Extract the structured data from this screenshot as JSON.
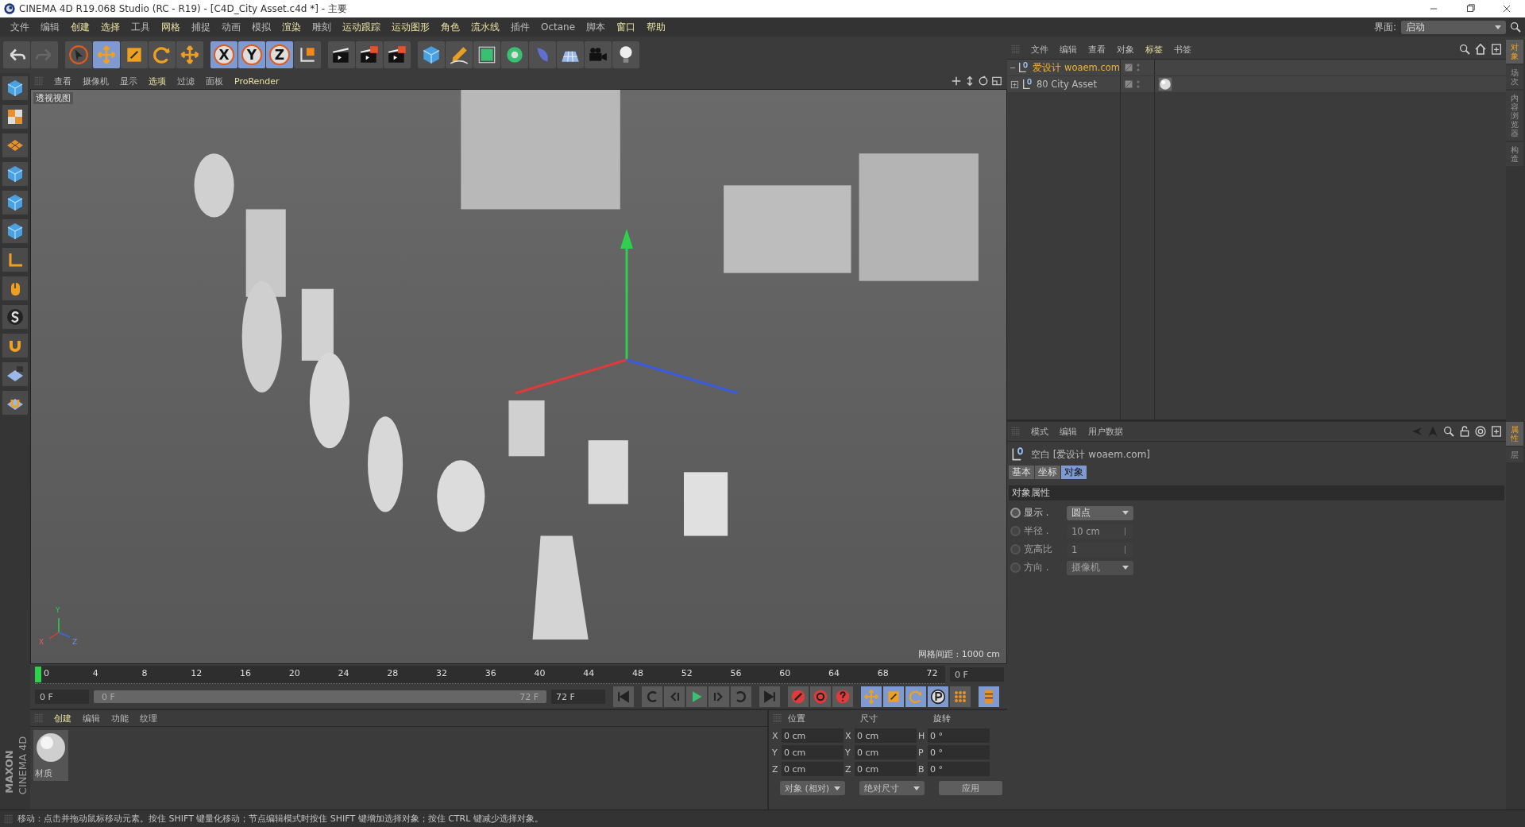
{
  "window": {
    "title": "CINEMA 4D R19.068 Studio (RC - R19) - [C4D_City Asset.c4d *] - 主要"
  },
  "menu_bar": [
    {
      "label": "文件",
      "highlighted": false
    },
    {
      "label": "编辑",
      "highlighted": false
    },
    {
      "label": "创建",
      "highlighted": true
    },
    {
      "label": "选择",
      "highlighted": true
    },
    {
      "label": "工具",
      "highlighted": false
    },
    {
      "label": "网格",
      "highlighted": true
    },
    {
      "label": "捕捉",
      "highlighted": false
    },
    {
      "label": "动画",
      "highlighted": false
    },
    {
      "label": "模拟",
      "highlighted": false
    },
    {
      "label": "渲染",
      "highlighted": true
    },
    {
      "label": "雕刻",
      "highlighted": false
    },
    {
      "label": "运动跟踪",
      "highlighted": true
    },
    {
      "label": "运动图形",
      "highlighted": true
    },
    {
      "label": "角色",
      "highlighted": true
    },
    {
      "label": "流水线",
      "highlighted": true
    },
    {
      "label": "插件",
      "highlighted": false
    },
    {
      "label": "Octane",
      "highlighted": false
    },
    {
      "label": "脚本",
      "highlighted": false
    },
    {
      "label": "窗口",
      "highlighted": true
    },
    {
      "label": "帮助",
      "highlighted": true
    }
  ],
  "layout_selector": {
    "label": "界面:",
    "value": "启动"
  },
  "toolbar": [
    {
      "kind": "undo",
      "selected": false
    },
    {
      "kind": "redo",
      "selected": false
    },
    {
      "kind": "select",
      "selected": false
    },
    {
      "kind": "move",
      "selected": true
    },
    {
      "kind": "scale",
      "selected": false
    },
    {
      "kind": "rotate",
      "selected": false
    },
    {
      "kind": "move",
      "selected": false
    },
    {
      "kind": "axis",
      "label": "X",
      "selected": true
    },
    {
      "kind": "axis",
      "label": "Y",
      "selected": true
    },
    {
      "kind": "axis",
      "label": "Z",
      "selected": true
    },
    {
      "kind": "coords",
      "selected": false
    },
    {
      "kind": "render-view",
      "selected": false
    },
    {
      "kind": "render-picture",
      "selected": false
    },
    {
      "kind": "render-settings",
      "selected": false
    },
    {
      "kind": "cube",
      "selected": false
    },
    {
      "kind": "pen",
      "selected": false
    },
    {
      "kind": "subdivide",
      "selected": false
    },
    {
      "kind": "cloner",
      "selected": false
    },
    {
      "kind": "deformer",
      "selected": false
    },
    {
      "kind": "floor",
      "selected": false
    },
    {
      "kind": "camera",
      "selected": false
    },
    {
      "kind": "light",
      "selected": false
    }
  ],
  "viewport": {
    "menu": [
      {
        "label": "查看",
        "highlighted": false
      },
      {
        "label": "摄像机",
        "highlighted": false
      },
      {
        "label": "显示",
        "highlighted": false
      },
      {
        "label": "选项",
        "highlighted": true
      },
      {
        "label": "过滤",
        "highlighted": false
      },
      {
        "label": "面板",
        "highlighted": false
      },
      {
        "label": "ProRender",
        "highlighted": true
      }
    ],
    "view_name": "透视视图",
    "axis_labels": [
      "Y",
      "X",
      "Z"
    ],
    "grid_spacing": "网格间距 : 1000 cm"
  },
  "timeline": {
    "ticks": [
      "0",
      "4",
      "8",
      "12",
      "16",
      "20",
      "24",
      "28",
      "32",
      "36",
      "40",
      "44",
      "48",
      "52",
      "56",
      "60",
      "64",
      "68",
      "72"
    ],
    "level": 0,
    "current_frame": "0 F",
    "start_frame": "0 F",
    "range_start": "0 F",
    "range_end": "72 F",
    "end_frame": "72 F"
  },
  "keyframe_tools": [
    {
      "kind": "move",
      "selected": true
    },
    {
      "kind": "scale",
      "selected": true
    },
    {
      "kind": "rotate",
      "selected": true
    },
    {
      "kind": "param",
      "selected": true
    },
    {
      "kind": "points",
      "selected": false
    }
  ],
  "material_manager": {
    "menu": [
      {
        "label": "创建",
        "highlighted": true
      },
      {
        "label": "编辑",
        "highlighted": false
      },
      {
        "label": "功能",
        "highlighted": false
      },
      {
        "label": "纹理",
        "highlighted": false
      }
    ],
    "materials": [
      {
        "name": "材质"
      }
    ]
  },
  "coordinates": {
    "headers": [
      "位置",
      "尺寸",
      "旋转"
    ],
    "rows": [
      {
        "labels": [
          "X",
          "X",
          "H"
        ],
        "values": [
          "0 cm",
          "0 cm",
          "0 °"
        ]
      },
      {
        "labels": [
          "Y",
          "Y",
          "P"
        ],
        "values": [
          "0 cm",
          "0 cm",
          "0 °"
        ]
      },
      {
        "labels": [
          "Z",
          "Z",
          "B"
        ],
        "values": [
          "0 cm",
          "0 cm",
          "0 °"
        ]
      }
    ],
    "mode": "对象 (相对)",
    "size_mode": "绝对尺寸",
    "apply": "应用"
  },
  "object_manager": {
    "menu": [
      {
        "label": "文件",
        "highlighted": false
      },
      {
        "label": "编辑",
        "highlighted": false
      },
      {
        "label": "查看",
        "highlighted": false
      },
      {
        "label": "对象",
        "highlighted": false
      },
      {
        "label": "标签",
        "highlighted": true
      },
      {
        "label": "书签",
        "highlighted": false
      }
    ],
    "objects": [
      {
        "name": "爱设计 woaem.com",
        "kind": "leaf",
        "selected": true,
        "has_tag": false
      },
      {
        "name": "80 City Asset",
        "kind": "group",
        "selected": false,
        "has_tag": true
      }
    ]
  },
  "attributes": {
    "menu": [
      "模式",
      "编辑",
      "用户数据"
    ],
    "object_label": "空白 [爱设计 woaem.com]",
    "tabs": [
      {
        "label": "基本",
        "selected": false
      },
      {
        "label": "坐标",
        "selected": false
      },
      {
        "label": "对象",
        "selected": true
      }
    ],
    "section": "对象属性",
    "properties": [
      {
        "label": "显示 .",
        "value": "圆点",
        "kind": "dropdown",
        "disabled": false
      },
      {
        "label": "半径 .",
        "value": "10 cm",
        "kind": "number",
        "disabled": true
      },
      {
        "label": "宽高比",
        "value": "1",
        "kind": "number",
        "disabled": true
      },
      {
        "label": "方向 .",
        "value": "摄像机",
        "kind": "dropdown",
        "disabled": true
      }
    ]
  },
  "side_tabs_top": [
    {
      "label": "对象",
      "selected": true
    },
    {
      "label": "场次",
      "selected": false
    },
    {
      "label": "内容浏览器",
      "selected": false
    },
    {
      "label": "构造",
      "selected": false
    }
  ],
  "side_tabs_bottom": [
    {
      "label": "属性",
      "selected": true
    },
    {
      "label": "层",
      "selected": false
    }
  ],
  "logo": [
    "MAXON",
    "CINEMA 4D"
  ],
  "status_bar": "移动：点击并拖动鼠标移动元素。按住 SHIFT 键量化移动；节点编辑模式时按住 SHIFT 键增加选择对象；按住 CTRL 键减少选择对象。"
}
